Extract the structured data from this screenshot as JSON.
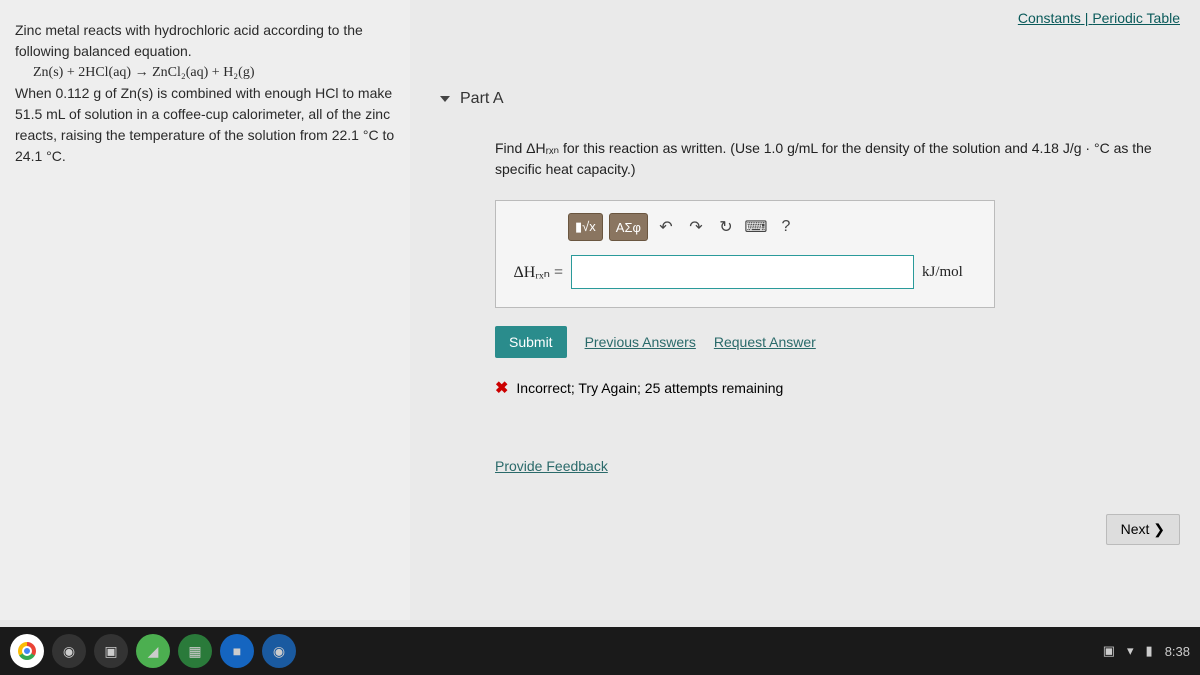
{
  "top_links": {
    "constants": "Constants",
    "sep": " | ",
    "periodic": "Periodic Table"
  },
  "problem": {
    "line1": "Zinc metal reacts with hydrochloric acid according to the following balanced equation.",
    "equation": "Zn(s) + 2HCl(aq) → ZnCl₂(aq) + H₂(g)",
    "line2": "When 0.112 g of Zn(s) is combined with enough HCl to make 51.5 mL of solution in a coffee-cup calorimeter, all of the zinc reacts, raising the temperature of the solution from 22.1 °C to 24.1 °C."
  },
  "part": {
    "label": "Part A",
    "prompt": "Find ΔHᵣₓₙ for this reaction as written. (Use 1.0 g/mL for the density of the solution and 4.18 J/g · °C as the specific heat capacity.)"
  },
  "toolbar": {
    "templates": "▮√x",
    "symbols": "ΑΣφ",
    "undo": "↶",
    "redo": "↷",
    "reset": "↻",
    "keyboard": "⌨",
    "help": "?"
  },
  "answer": {
    "variable": "ΔHᵣₓₙ =",
    "value": "",
    "unit": "kJ/mol"
  },
  "buttons": {
    "submit": "Submit",
    "previous": "Previous Answers",
    "request": "Request Answer",
    "next": "Next ❯"
  },
  "status": {
    "text": "Incorrect; Try Again; 25 attempts remaining"
  },
  "footer_link": "Provide Feedback",
  "system": {
    "time": "8:38"
  }
}
